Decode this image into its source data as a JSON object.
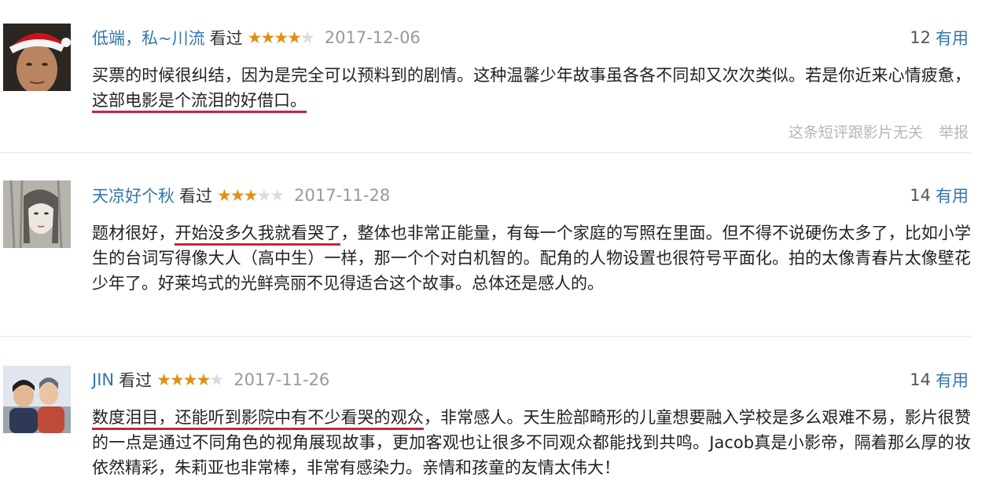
{
  "comments": [
    {
      "user": "低端，私~川流",
      "watched": "看过",
      "rating": 4,
      "date": "2017-12-06",
      "useful_count": "12",
      "useful_label": "有用",
      "text_parts": [
        "买票的时候很纠结，因为是完全可以预料到的剧情。这种温馨少年故事虽各各不同却又次次类似。若是你近来心情疲惫，",
        "这部电影是个流泪的好借口。",
        ""
      ],
      "highlight_index": 1,
      "irrelevant_label": "这条短评跟影片无关",
      "report_label": "举报"
    },
    {
      "user": "天凉好个秋",
      "watched": "看过",
      "rating": 3,
      "date": "2017-11-28",
      "useful_count": "14",
      "useful_label": "有用",
      "text_parts": [
        "题材很好，",
        "开始没多久我就看哭了",
        "，整体也非常正能量，有每一个家庭的写照在里面。但不得不说硬伤太多了，比如小学生的台词写得像大人（高中生）一样，那一个个对白机智的。配角的人物设置也很符号平面化。拍的太像青春片太像壁花少年了。好莱坞式的光鲜亮丽不见得适合这个故事。总体还是感人的。"
      ],
      "highlight_index": 1
    },
    {
      "user": "JIN",
      "watched": "看过",
      "rating": 4,
      "date": "2017-11-26",
      "useful_count": "14",
      "useful_label": "有用",
      "text_parts": [
        "",
        "数度泪目，还能听到影院中有不少看哭的观众",
        "，非常感人。天生脸部畸形的儿童想要融入学校是多么艰难不易，影片很赞的一点是通过不同角色的视角展现故事，更加客观也让很多不同观众都能找到共鸣。Jacob真是小影帝，隔着那么厚的妆依然精彩，朱莉亚也非常棒，非常有感染力。亲情和孩童的友情太伟大！"
      ],
      "highlight_index": 1
    }
  ],
  "colors": {
    "link": "#3377aa",
    "star": "#e09015",
    "highlight_underline": "#c6273a",
    "muted": "#999999"
  },
  "icons": [
    "avatar-santa-hat-man",
    "avatar-illustrated-woman",
    "avatar-couple-photo",
    "star-icon"
  ]
}
